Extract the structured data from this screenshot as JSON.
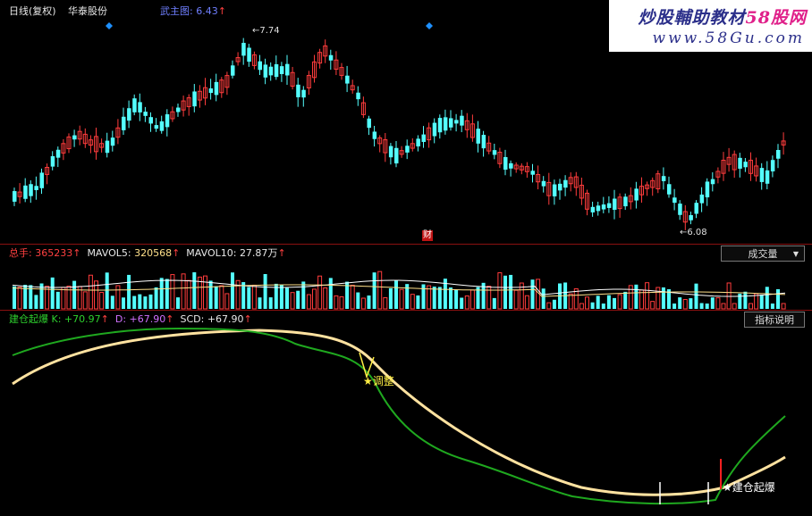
{
  "header": {
    "period": "日线(复权)",
    "stock_name": "华泰股份",
    "main_indicator_label": "武主图",
    "main_indicator_value": "6.43",
    "high_label": "7.74",
    "low_label": "6.08",
    "event_marker": "财"
  },
  "watermark": {
    "title_main": "炒股輔助教材",
    "title_site": "58股网",
    "url": "www.58Gu.com"
  },
  "volume_panel": {
    "total_label": "总手:",
    "total_value": "365233",
    "ma5_label": "MAVOL5:",
    "ma5_value": "320568",
    "ma10_label": "MAVOL10:",
    "ma10_value": "27.87万",
    "dropdown_label": "成交量"
  },
  "indicator_panel": {
    "name": "建仓起爆",
    "k_label": "K:",
    "k_value": "+70.97",
    "d_label": "D:",
    "d_value": "+67.90",
    "scd_label": "SCD:",
    "scd_value": "+67.90",
    "help_button": "指标说明",
    "signal_adjust": "调整",
    "signal_launch": "建仓起爆"
  },
  "colors": {
    "up": "#ff3c3c",
    "down": "#54ffff",
    "k_line": "#1fa81f",
    "d_line": "#ffe2a0",
    "separator": "#8a1010",
    "marker": "#1e90ff"
  }
}
